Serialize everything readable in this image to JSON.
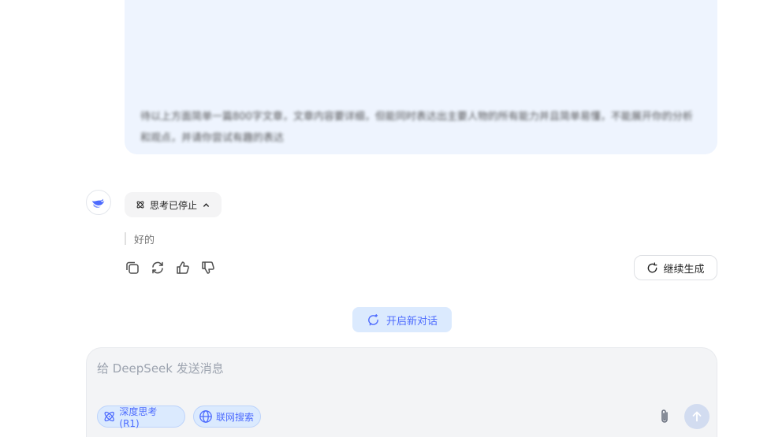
{
  "user_message": {
    "text": "待以上方面简单一篇800字文章，文章内容要详细，但能同时表达出主要人物的所有能力并且简单易懂，不能展开你的分析和观点，并请你尝试有趣的表达"
  },
  "assistant": {
    "avatar_icon": "deepseek-whale-icon",
    "think_toggle_label": "思考已停止",
    "reply_text": "好的",
    "actions": [
      "copy-icon",
      "regenerate-icon",
      "thumbs-up-icon",
      "thumbs-down-icon"
    ],
    "continue_label": "继续生成"
  },
  "new_chat_label": "开启新对话",
  "composer": {
    "placeholder": "给 DeepSeek 发送消息",
    "value": "",
    "deep_think_label": "深度思考 (R1)",
    "web_search_label": "联网搜索"
  },
  "colors": {
    "accent": "#4d6bfe",
    "user_bubble": "#eef4fe",
    "chip_bg": "#dbeafe",
    "composer_bg": "#f3f4f6"
  }
}
